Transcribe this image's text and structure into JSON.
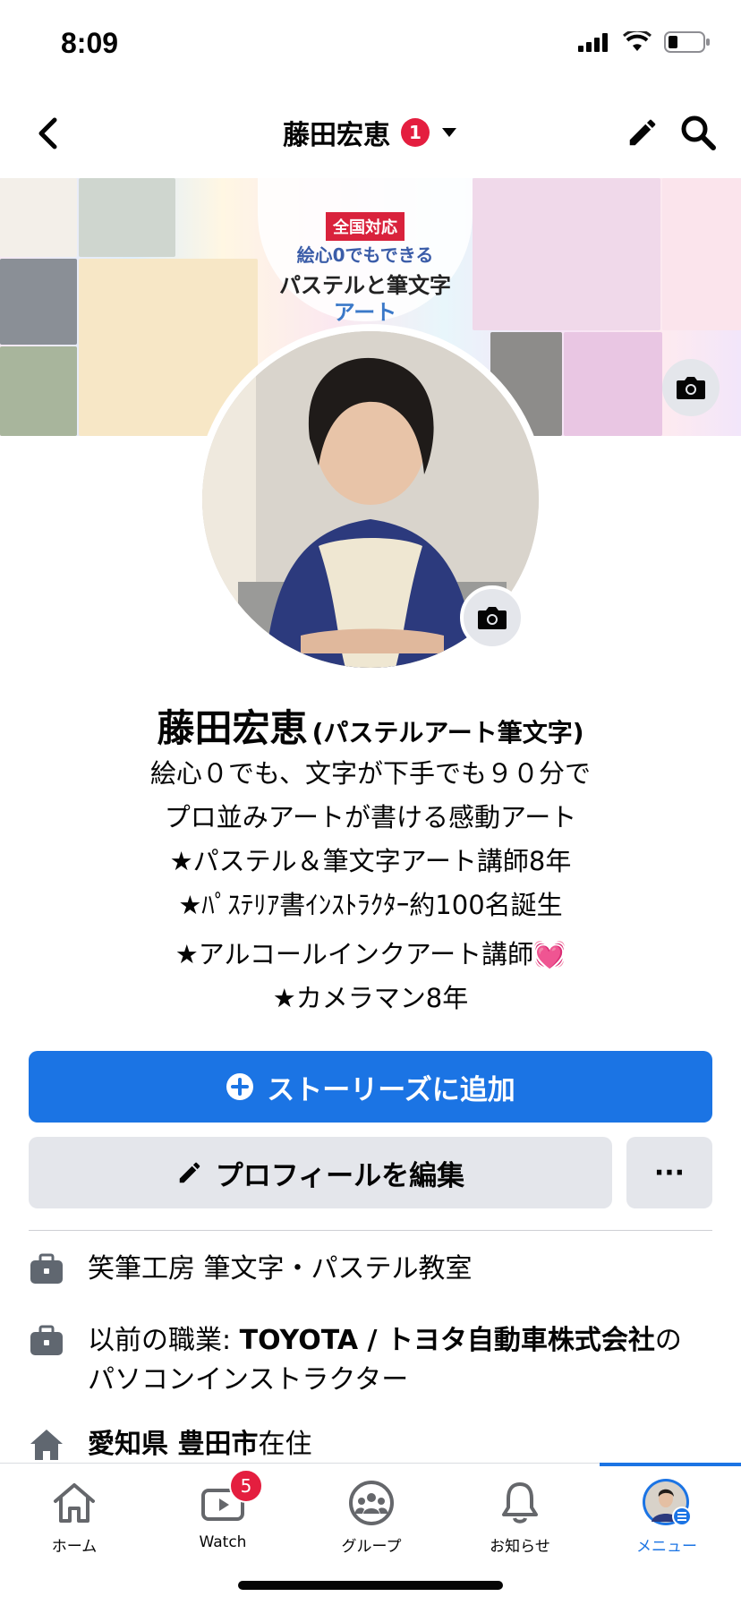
{
  "status": {
    "time": "8:09"
  },
  "header": {
    "title": "藤田宏恵",
    "notification_count": "1"
  },
  "cover": {
    "banner_tag": "全国対応",
    "banner_line1": "絵心0でもできる",
    "banner_line2": "パステルと筆文字",
    "banner_line3": "アート"
  },
  "profile": {
    "name": "藤田宏恵",
    "name_suffix": "(パステルアート筆文字)",
    "bio": [
      "絵心０でも、文字が下手でも９０分で",
      "プロ並みアートが書ける感動アート",
      "★パステル＆筆文字アート講師8年",
      "★ﾊﾟｽﾃﾘｱ書ｲﾝｽﾄﾗｸﾀｰ約100名誕生",
      "★アルコールインクアート講師💓",
      "★カメラマン8年"
    ]
  },
  "actions": {
    "add_story": "ストーリーズに追加",
    "edit_profile": "プロフィールを編集",
    "more": "···"
  },
  "details": {
    "work": "笑筆工房 筆文字・パステル教室",
    "prev_prefix": "以前の職業: ",
    "prev_company": "TOYOTA / トヨタ自動車株式会社",
    "prev_suffix": "の",
    "prev_line2": "パソコンインストラクター",
    "home_bold": "愛知県 豊田市",
    "home_suffix": "在住"
  },
  "tabs": {
    "home": "ホーム",
    "watch": "Watch",
    "watch_badge": "5",
    "groups": "グループ",
    "notifications": "お知らせ",
    "menu": "メニュー"
  },
  "colors": {
    "accent": "#1b74e4",
    "badge": "#e41e3f",
    "button_gray": "#e4e6eb"
  }
}
